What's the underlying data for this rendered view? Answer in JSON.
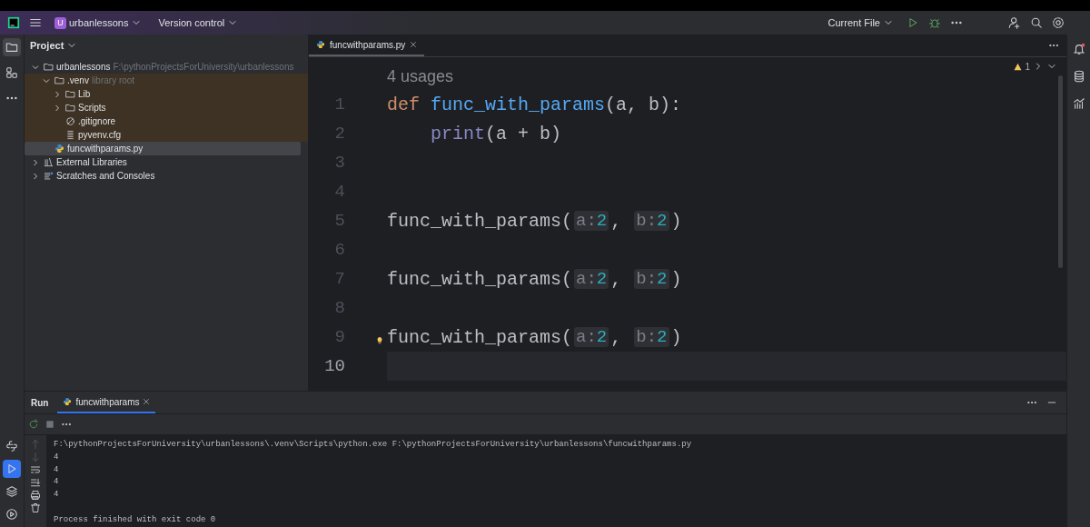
{
  "title_bar": {
    "project": {
      "badge": "U",
      "name": "urbanlessons"
    },
    "vcs": "Version control",
    "run_config": "Current File"
  },
  "left_tools": [
    {
      "kind": "folder",
      "selected": true
    },
    {
      "kind": "structure",
      "selected": false
    },
    {
      "kind": "more",
      "selected": false
    }
  ],
  "project_panel": {
    "title": "Project",
    "tree": [
      {
        "label": "urbanlessons",
        "hint": "F:\\pythonProjectsForUniversity\\urbanlessons",
        "kind": "folder",
        "expanded": true,
        "selected": false,
        "children": [
          {
            "label": ".venv",
            "hint": "library root",
            "kind": "folder",
            "expanded": true,
            "excluded": true,
            "selected": false,
            "children": [
              {
                "label": "Lib",
                "kind": "folder",
                "expanded": false,
                "selected": false
              },
              {
                "label": "Scripts",
                "kind": "folder",
                "expanded": false,
                "selected": false
              },
              {
                "label": ".gitignore",
                "kind": "ignore",
                "selected": false
              },
              {
                "label": "pyvenv.cfg",
                "kind": "text",
                "selected": false
              }
            ]
          },
          {
            "label": "funcwithparams.py",
            "kind": "python",
            "selected": true
          }
        ]
      },
      {
        "label": "External Libraries",
        "kind": "library",
        "expanded": false,
        "selected": false
      },
      {
        "label": "Scratches and Consoles",
        "kind": "scratches",
        "expanded": false,
        "selected": false
      }
    ]
  },
  "editor": {
    "tabs": [
      {
        "label": "funcwithparams.py",
        "selected": true
      }
    ],
    "warnings": "1",
    "usages": "4 usages",
    "lines": [
      {
        "number": "1",
        "current": false,
        "tokens": [
          {
            "kind": "keyword",
            "text": "def "
          },
          {
            "kind": "function",
            "text": "func_with_params"
          },
          {
            "kind": "plain",
            "text": "(a, b):"
          }
        ],
        "children": [
          {
            "number": "2",
            "current": false,
            "tokens": [
              {
                "kind": "builtin",
                "text": "print"
              },
              {
                "kind": "plain",
                "text": "(a + b)"
              }
            ]
          }
        ]
      },
      {
        "number": "3",
        "current": false
      },
      {
        "number": "4",
        "current": false
      },
      {
        "number": "5",
        "current": false,
        "tokens": [
          {
            "kind": "plain",
            "text": "func_with_params("
          },
          {
            "kind": "hint",
            "name": "a:",
            "value": "2"
          },
          {
            "kind": "plain",
            "text": ", "
          },
          {
            "kind": "hint",
            "name": "b:",
            "value": "2"
          },
          {
            "kind": "plain",
            "text": ")"
          }
        ]
      },
      {
        "number": "6",
        "current": false
      },
      {
        "number": "7",
        "current": false,
        "tokens": [
          {
            "kind": "plain",
            "text": "func_with_params("
          },
          {
            "kind": "hint",
            "name": "a:",
            "value": "2"
          },
          {
            "kind": "plain",
            "text": ", "
          },
          {
            "kind": "hint",
            "name": "b:",
            "value": "2"
          },
          {
            "kind": "plain",
            "text": ")"
          }
        ]
      },
      {
        "number": "8",
        "current": false
      },
      {
        "number": "9",
        "current": false,
        "bulb": true,
        "tokens": [
          {
            "kind": "plain",
            "text": "func_with_params("
          },
          {
            "kind": "hint",
            "name": "a:",
            "value": "2"
          },
          {
            "kind": "plain",
            "text": ", "
          },
          {
            "kind": "hint",
            "name": "b:",
            "value": "2"
          },
          {
            "kind": "plain",
            "text": ")"
          }
        ]
      },
      {
        "number": "10",
        "current": true
      }
    ]
  },
  "right_tools": [
    {
      "kind": "bell",
      "badge": true
    },
    {
      "kind": "database"
    },
    {
      "kind": "chart"
    }
  ],
  "bottom_left_tools": [
    {
      "kind": "python-console",
      "selected": false
    },
    {
      "kind": "run",
      "selected": true
    },
    {
      "kind": "layers",
      "selected": false
    },
    {
      "kind": "services",
      "selected": false
    }
  ],
  "run_panel": {
    "title": "Run",
    "tabs": [
      {
        "label": "funcwithparams",
        "selected": true
      }
    ],
    "output": [
      {
        "kind": "command",
        "text": "F:\\pythonProjectsForUniversity\\urbanlessons\\.venv\\Scripts\\python.exe F:\\pythonProjectsForUniversity\\urbanlessons\\funcwithparams.py"
      },
      {
        "kind": "stdout",
        "text": "4"
      },
      {
        "kind": "stdout",
        "text": "4"
      },
      {
        "kind": "stdout",
        "text": "4"
      },
      {
        "kind": "stdout",
        "text": "4"
      },
      {
        "kind": "status",
        "text": "Process finished with exit code 0"
      }
    ]
  }
}
